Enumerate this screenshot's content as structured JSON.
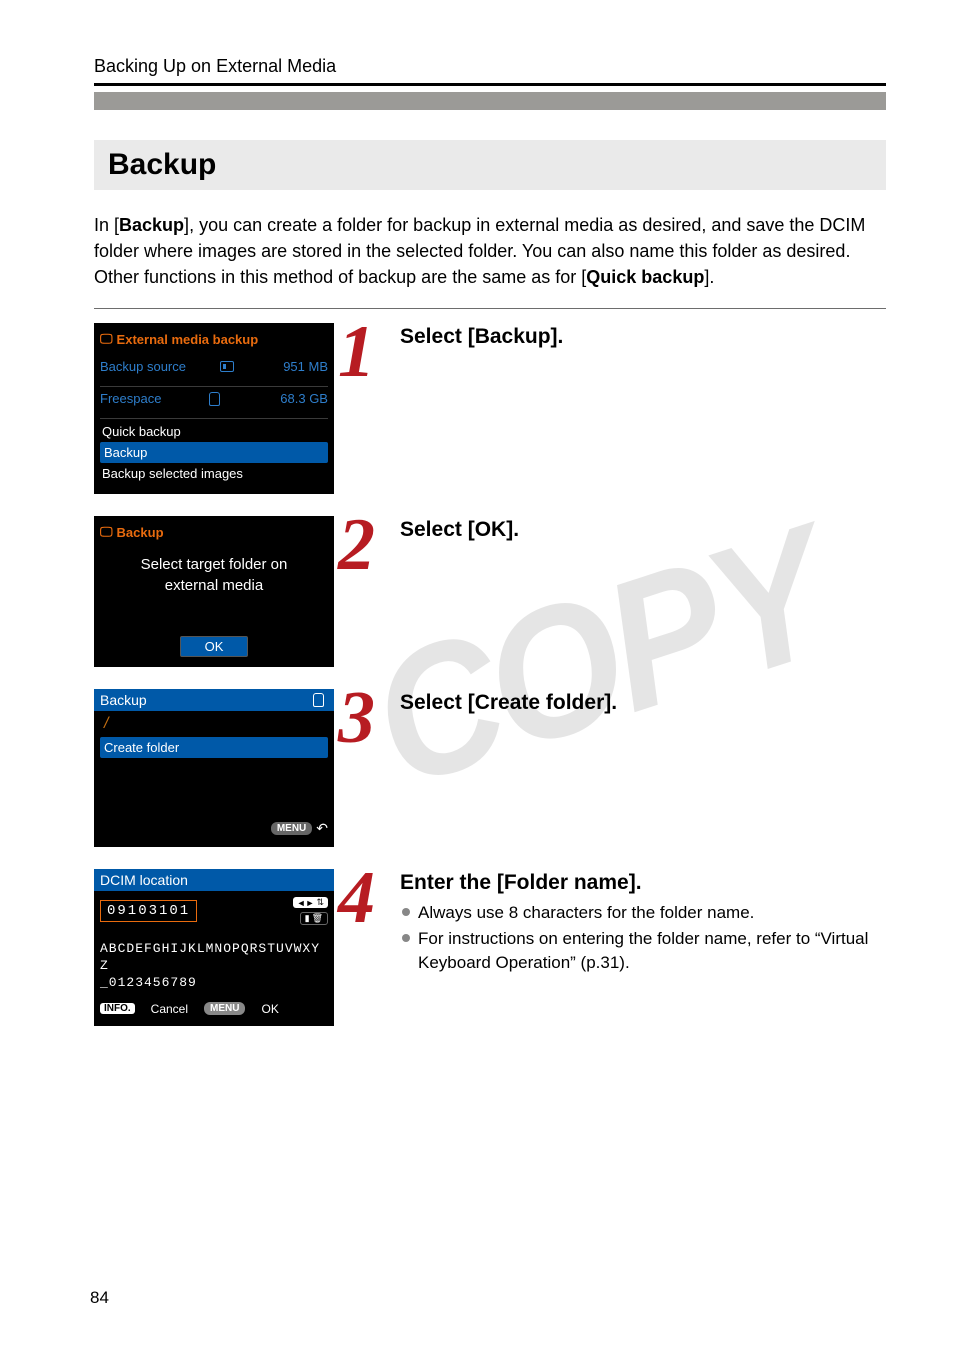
{
  "header": "Backing Up on External Media",
  "title": "Backup",
  "watermark": "COPY",
  "intro": {
    "bold1": "Backup",
    "part1": ", you can create a folder for backup in external media as desired, and save the DCIM folder where images are stored in the selected folder. You can also name this folder as desired. Other functions in this method of backup are the same as for ",
    "bold2": "Quick backup"
  },
  "steps": [
    {
      "num": "1",
      "title": "Select [Backup]."
    },
    {
      "num": "2",
      "title": "Select [OK]."
    },
    {
      "num": "3",
      "title": "Select [Create folder]."
    },
    {
      "num": "4",
      "title": "Enter the [Folder name].",
      "bullets": [
        "Always use 8 characters for the folder name.",
        "For instructions on entering the folder name, refer to “Virtual Keyboard Operation” (p.31)."
      ]
    }
  ],
  "shots": [
    {
      "title": "External media backup",
      "source_label": "Backup source",
      "source_value": "951 MB",
      "freespace_label": "Freespace",
      "freespace_value": "68.3 GB",
      "opts": [
        "Quick backup",
        "Backup",
        "Backup selected images"
      ]
    },
    {
      "title": "Backup",
      "line1": "Select target folder on",
      "line2": "external media",
      "ok": "OK"
    },
    {
      "heading": "Backup",
      "path": "/",
      "create": "Create folder",
      "menu_chip": "MENU"
    },
    {
      "heading": "DCIM location",
      "folder_name": "09103101",
      "kbd1": "ABCDEFGHIJKLMNOPQRSTUVWXYZ",
      "kbd2": "_0123456789",
      "info_chip": "INFO.",
      "cancel": "Cancel",
      "menu_chip": "MENU",
      "ok": "OK"
    }
  ],
  "page_number": "84"
}
